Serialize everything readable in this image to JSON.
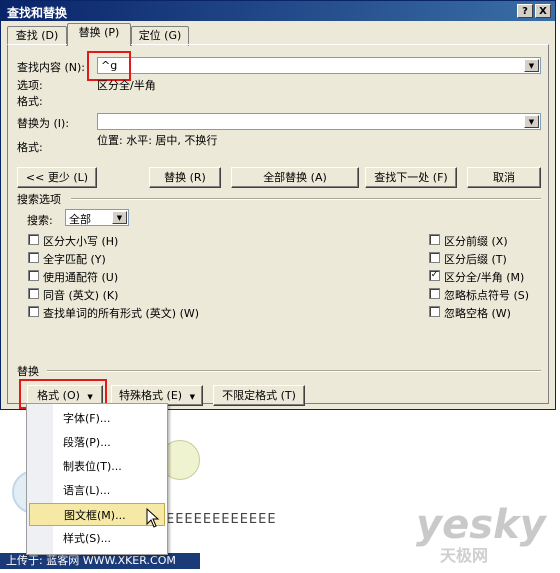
{
  "dialog": {
    "title": "查找和替换",
    "help_label": "?",
    "close_label": "X",
    "tabs": [
      {
        "label": "查找 (D)"
      },
      {
        "label": "替换 (P)"
      },
      {
        "label": "定位 (G)"
      }
    ],
    "find": {
      "label": "查找内容 (N):",
      "value": "^g",
      "options_label": "选项:",
      "options_value": "区分全/半角",
      "format_label": "格式:"
    },
    "replace": {
      "label": "替换为 (I):",
      "value": "",
      "format_label": "格式:",
      "format_value": "位置: 水平: 居中, 不换行"
    },
    "buttons": {
      "less": "<< 更少 (L)",
      "replace": "替换 (R)",
      "replace_all": "全部替换 (A)",
      "find_next": "查找下一处 (F)",
      "cancel": "取消"
    },
    "search_options": {
      "section_label": "搜索选项",
      "search_label": "搜索:",
      "search_value": "全部",
      "left_checks": [
        {
          "label": "区分大小写 (H)",
          "checked": false
        },
        {
          "label": "全字匹配 (Y)",
          "checked": false
        },
        {
          "label": "使用通配符 (U)",
          "checked": false
        },
        {
          "label": "同音 (英文) (K)",
          "checked": false
        },
        {
          "label": "查找单词的所有形式 (英文) (W)",
          "checked": false
        }
      ],
      "right_checks": [
        {
          "label": "区分前缀 (X)",
          "checked": false
        },
        {
          "label": "区分后缀 (T)",
          "checked": false
        },
        {
          "label": "区分全/半角 (M)",
          "checked": true
        },
        {
          "label": "忽略标点符号 (S)",
          "checked": false
        },
        {
          "label": "忽略空格 (W)",
          "checked": false
        }
      ]
    },
    "replace_section": {
      "label": "替换",
      "format_button": "格式 (O)",
      "special_button": "特殊格式 (E)",
      "no_format_button": "不限定格式 (T)"
    }
  },
  "format_menu": {
    "items": [
      {
        "label": "字体(F)..."
      },
      {
        "label": "段落(P)..."
      },
      {
        "label": "制表位(T)..."
      },
      {
        "label": "语言(L)..."
      },
      {
        "label": "图文框(M)..."
      },
      {
        "label": "样式(S)..."
      }
    ],
    "highlighted_index": 4
  },
  "background": {
    "doc_text": "EEEEEEEEEEEE",
    "watermark_brand": "yesky",
    "watermark_sub": "天极网",
    "footer": "上传于: 蓝客网 WWW.XKER.COM"
  },
  "colors": {
    "highlight_box": "#e21a1a",
    "titlebar": "#0a246a",
    "dialog_bg": "#ece9d8"
  }
}
